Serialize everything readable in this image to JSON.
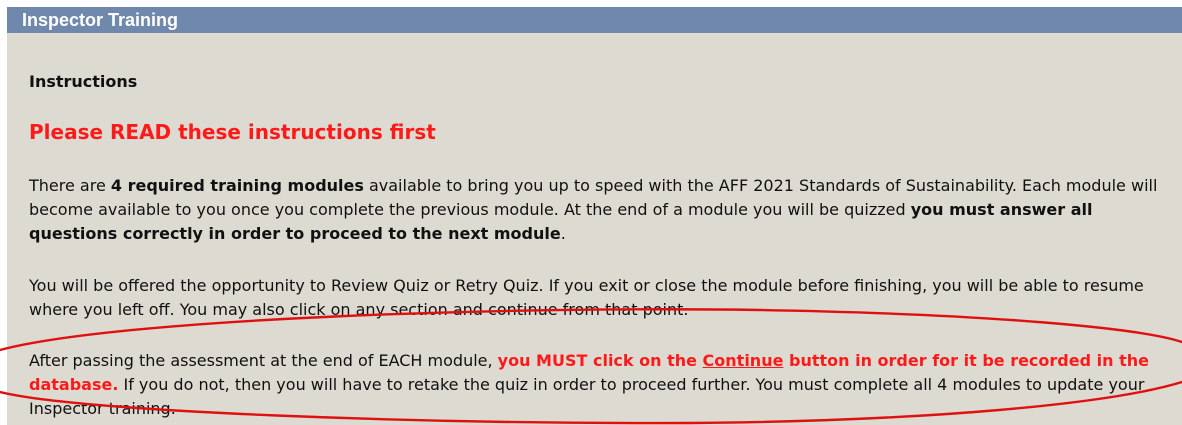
{
  "panel": {
    "title": "Inspector Training"
  },
  "instructions": {
    "heading": "Instructions",
    "warning": "Please READ these instructions first"
  },
  "paragraph1": {
    "part1": "There are ",
    "bold1": "4 required training modules",
    "part2": " available to bring you up to speed with the AFF 2021 Standards of Sustainability. Each module will become available to you once you complete the previous module. At the end of a module you will be quizzed ",
    "bold2": "you must answer all questions correctly in order to proceed to the next module",
    "part3": "."
  },
  "paragraph2": {
    "text": "You will be offered the opportunity to Review Quiz or Retry Quiz. If you exit or close the module before finishing, you will be able to resume where you left off. You may also click on any section and continue from that point."
  },
  "paragraph3": {
    "part1": "After passing the assessment at the end of EACH module, ",
    "red1": "you MUST click on the ",
    "continue_word": "Continue",
    "red2": " button in order for it be recorded in the database.",
    "part2": " If you do not, then you will have to retake the quiz in order to proceed further. You must complete all 4 modules to update your Inspector training."
  },
  "colors": {
    "header_bg": "#6f88ac",
    "panel_bg": "#dcdad1",
    "accent_red": "#ff1a1a",
    "annotation_ellipse": "#e01010"
  }
}
